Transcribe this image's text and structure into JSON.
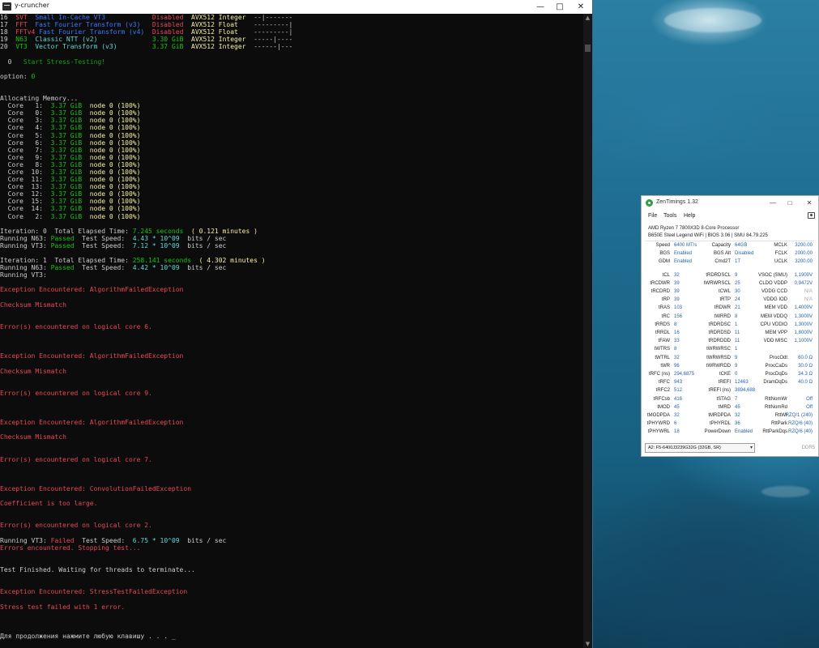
{
  "terminal": {
    "title": "y-cruncher",
    "lines": [
      [
        [
          "16  ",
          "w"
        ],
        [
          "SVT  ",
          "r"
        ],
        [
          "Small In-Cache VT3            ",
          "b"
        ],
        [
          "Disabled  ",
          "r"
        ],
        [
          "AVX512 Integer  ",
          "y"
        ],
        [
          "--|-------",
          "w"
        ]
      ],
      [
        [
          "17  ",
          "w"
        ],
        [
          "FFT  ",
          "r"
        ],
        [
          "Fast Fourier Transform (v3)   ",
          "b"
        ],
        [
          "Disabled  ",
          "r"
        ],
        [
          "AVX512 Float    ",
          "y"
        ],
        [
          "---------|",
          "w"
        ]
      ],
      [
        [
          "18  ",
          "w"
        ],
        [
          "FFTv4",
          "r"
        ],
        [
          " Fast Fourier Transform (v4)  ",
          "b"
        ],
        [
          "Disabled  ",
          "r"
        ],
        [
          "AVX512 Float    ",
          "y"
        ],
        [
          "---------|",
          "w"
        ]
      ],
      [
        [
          "19  ",
          "w"
        ],
        [
          "N63  ",
          "g"
        ],
        [
          "Classic NTT (v2)              ",
          "c"
        ],
        [
          "3.30 GiB  ",
          "g"
        ],
        [
          "AVX512 Integer  ",
          "y"
        ],
        [
          "-----|----",
          "w"
        ]
      ],
      [
        [
          "20  ",
          "w"
        ],
        [
          "VT3  ",
          "g"
        ],
        [
          "Vector Transform (v3)         ",
          "c"
        ],
        [
          "3.37 GiB  ",
          "g"
        ],
        [
          "AVX512 Integer  ",
          "y"
        ],
        [
          "------|---",
          "w"
        ]
      ],
      [],
      [
        [
          "  0   ",
          "w"
        ],
        [
          "Start Stress-Testing!",
          "lg"
        ]
      ],
      [],
      [
        [
          "option: ",
          "w"
        ],
        [
          "0",
          "g"
        ]
      ],
      [],
      [],
      [
        [
          "Allocating Memory...",
          "w"
        ]
      ],
      [
        [
          "  Core   1:  ",
          "w"
        ],
        [
          "3.37 GiB",
          "g"
        ],
        [
          "  node 0 (100%)",
          "y"
        ]
      ],
      [
        [
          "  Core   0:  ",
          "w"
        ],
        [
          "3.37 GiB",
          "g"
        ],
        [
          "  node 0 (100%)",
          "y"
        ]
      ],
      [
        [
          "  Core   3:  ",
          "w"
        ],
        [
          "3.37 GiB",
          "g"
        ],
        [
          "  node 0 (100%)",
          "y"
        ]
      ],
      [
        [
          "  Core   4:  ",
          "w"
        ],
        [
          "3.37 GiB",
          "g"
        ],
        [
          "  node 0 (100%)",
          "y"
        ]
      ],
      [
        [
          "  Core   5:  ",
          "w"
        ],
        [
          "3.37 GiB",
          "g"
        ],
        [
          "  node 0 (100%)",
          "y"
        ]
      ],
      [
        [
          "  Core   6:  ",
          "w"
        ],
        [
          "3.37 GiB",
          "g"
        ],
        [
          "  node 0 (100%)",
          "y"
        ]
      ],
      [
        [
          "  Core   7:  ",
          "w"
        ],
        [
          "3.37 GiB",
          "g"
        ],
        [
          "  node 0 (100%)",
          "y"
        ]
      ],
      [
        [
          "  Core   9:  ",
          "w"
        ],
        [
          "3.37 GiB",
          "g"
        ],
        [
          "  node 0 (100%)",
          "y"
        ]
      ],
      [
        [
          "  Core   8:  ",
          "w"
        ],
        [
          "3.37 GiB",
          "g"
        ],
        [
          "  node 0 (100%)",
          "y"
        ]
      ],
      [
        [
          "  Core  10:  ",
          "w"
        ],
        [
          "3.37 GiB",
          "g"
        ],
        [
          "  node 0 (100%)",
          "y"
        ]
      ],
      [
        [
          "  Core  11:  ",
          "w"
        ],
        [
          "3.37 GiB",
          "g"
        ],
        [
          "  node 0 (100%)",
          "y"
        ]
      ],
      [
        [
          "  Core  13:  ",
          "w"
        ],
        [
          "3.37 GiB",
          "g"
        ],
        [
          "  node 0 (100%)",
          "y"
        ]
      ],
      [
        [
          "  Core  12:  ",
          "w"
        ],
        [
          "3.37 GiB",
          "g"
        ],
        [
          "  node 0 (100%)",
          "y"
        ]
      ],
      [
        [
          "  Core  15:  ",
          "w"
        ],
        [
          "3.37 GiB",
          "g"
        ],
        [
          "  node 0 (100%)",
          "y"
        ]
      ],
      [
        [
          "  Core  14:  ",
          "w"
        ],
        [
          "3.37 GiB",
          "g"
        ],
        [
          "  node 0 (100%)",
          "y"
        ]
      ],
      [
        [
          "  Core   2:  ",
          "w"
        ],
        [
          "3.37 GiB",
          "g"
        ],
        [
          "  node 0 (100%)",
          "y"
        ]
      ],
      [],
      [
        [
          "Iteration: 0  Total Elapsed Time: ",
          "w"
        ],
        [
          "7.245 seconds",
          "g"
        ],
        [
          "  ( 0.121 minutes )",
          "y"
        ]
      ],
      [
        [
          "Running N63: ",
          "w"
        ],
        [
          "Passed",
          "g"
        ],
        [
          "  Test Speed:  ",
          "w"
        ],
        [
          "4.43 * 10^09",
          "c"
        ],
        [
          "  bits / sec",
          "w"
        ]
      ],
      [
        [
          "Running VT3: ",
          "w"
        ],
        [
          "Passed",
          "g"
        ],
        [
          "  Test Speed:  ",
          "w"
        ],
        [
          "7.12 * 10^09",
          "c"
        ],
        [
          "  bits / sec",
          "w"
        ]
      ],
      [],
      [
        [
          "Iteration: 1  Total Elapsed Time: ",
          "w"
        ],
        [
          "258.141 seconds",
          "g"
        ],
        [
          "  ( 4.302 minutes )",
          "y"
        ]
      ],
      [
        [
          "Running N63: ",
          "w"
        ],
        [
          "Passed",
          "g"
        ],
        [
          "  Test Speed:  ",
          "w"
        ],
        [
          "4.42 * 10^09",
          "c"
        ],
        [
          "  bits / sec",
          "w"
        ]
      ],
      [
        [
          "Running VT3:",
          "w"
        ]
      ],
      [],
      [
        [
          "Exception Encountered: AlgorithmFailedException",
          "r"
        ]
      ],
      [],
      [
        [
          "Checksum Mismatch",
          "r"
        ]
      ],
      [],
      [],
      [
        [
          "Error(s) encountered on logical core 6.",
          "r"
        ]
      ],
      [],
      [],
      [],
      [
        [
          "Exception Encountered: AlgorithmFailedException",
          "r"
        ]
      ],
      [],
      [
        [
          "Checksum Mismatch",
          "r"
        ]
      ],
      [],
      [],
      [
        [
          "Error(s) encountered on logical core 9.",
          "r"
        ]
      ],
      [],
      [],
      [],
      [
        [
          "Exception Encountered: AlgorithmFailedException",
          "r"
        ]
      ],
      [],
      [
        [
          "Checksum Mismatch",
          "r"
        ]
      ],
      [],
      [],
      [
        [
          "Error(s) encountered on logical core 7.",
          "r"
        ]
      ],
      [],
      [],
      [],
      [
        [
          "Exception Encountered: ConvolutionFailedException",
          "r"
        ]
      ],
      [],
      [
        [
          "Coefficient is too large.",
          "r"
        ]
      ],
      [],
      [],
      [
        [
          "Error(s) encountered on logical core 2.",
          "r"
        ]
      ],
      [],
      [
        [
          "Running VT3: ",
          "w"
        ],
        [
          "Failed",
          "r"
        ],
        [
          "  Test Speed:  ",
          "w"
        ],
        [
          "6.75 * 10^09",
          "c"
        ],
        [
          "  bits / sec",
          "w"
        ]
      ],
      [
        [
          "Errors encountered. Stopping test...",
          "r"
        ]
      ],
      [],
      [],
      [
        [
          "Test Finished. Waiting for threads to terminate...",
          "w"
        ]
      ],
      [],
      [],
      [
        [
          "Exception Encountered: StressTestFailedException",
          "r"
        ]
      ],
      [],
      [
        [
          "Stress test failed with 1 error.",
          "r"
        ]
      ],
      [],
      [],
      [],
      [
        [
          "Для продолжения нажмите любую клавишу . . . _",
          "w"
        ]
      ]
    ]
  },
  "zentimings": {
    "title": "ZenTimings 1.32",
    "menu": [
      "File",
      "Tools",
      "Help"
    ],
    "cpu": "AMD Ryzen 7 7800X3D 8-Core Processor",
    "board": "B650E Steel Legend WiFi | BIOS 3.06 | SMU 84.79.225",
    "rows": [
      [
        [
          "Speed",
          "6400 MT/s"
        ],
        [
          "Capacity",
          "64GB"
        ],
        [
          "MCLK",
          "3200.00"
        ]
      ],
      [
        [
          "BGS",
          "Enabled"
        ],
        [
          "BGS Alt",
          "Disabled"
        ],
        [
          "FCLK",
          "2000.00"
        ]
      ],
      [
        [
          "GDM",
          "Enabled"
        ],
        [
          "Cmd2T",
          "1T"
        ],
        [
          "UCLK",
          "3200.00"
        ]
      ],
      null,
      [
        [
          "tCL",
          "32"
        ],
        [
          "tRDRDSCL",
          "9"
        ],
        [
          "VSOC (SMU)",
          "1,1900V"
        ]
      ],
      [
        [
          "tRCDWR",
          "39"
        ],
        [
          "tWRWRSCL",
          "25"
        ],
        [
          "CLDO VDDP",
          "0,9472V"
        ]
      ],
      [
        [
          "tRCDRD",
          "39"
        ],
        [
          "tCWL",
          "30"
        ],
        [
          "VDDG CCD",
          "N/A"
        ]
      ],
      [
        [
          "tRP",
          "39"
        ],
        [
          "tRTP",
          "24"
        ],
        [
          "VDDG IOD",
          "N/A"
        ]
      ],
      [
        [
          "tRAS",
          "103"
        ],
        [
          "tRDWR",
          "21"
        ],
        [
          "MEM VDD",
          "1,4000V"
        ]
      ],
      [
        [
          "tRC",
          "156"
        ],
        [
          "tWRRD",
          "8"
        ],
        [
          "MEM VDDQ",
          "1,3000V"
        ]
      ],
      [
        [
          "tRRDS",
          "8"
        ],
        [
          "tRDRDSC",
          "1"
        ],
        [
          "CPU VDDIO",
          "1,3000V"
        ]
      ],
      [
        [
          "tRRDL",
          "16"
        ],
        [
          "tRDRDSD",
          "11"
        ],
        [
          "MEM VPP",
          "1,8000V"
        ]
      ],
      [
        [
          "tFAW",
          "33"
        ],
        [
          "tRDRDDD",
          "11"
        ],
        [
          "VDD MISC",
          "1,1000V"
        ]
      ],
      [
        [
          "tWTRS",
          "8"
        ],
        [
          "tWRWRSC",
          "1"
        ],
        [
          "",
          ""
        ]
      ],
      [
        [
          "tWTRL",
          "32"
        ],
        [
          "tWRWRSD",
          "9"
        ],
        [
          "ProcOdt",
          "60.0 Ω"
        ]
      ],
      [
        [
          "tWR",
          "96"
        ],
        [
          "tWRWRDD",
          "9"
        ],
        [
          "ProcCaDs",
          "30.0 Ω"
        ]
      ],
      [
        [
          "tRFC (ns)",
          "294,6875"
        ],
        [
          "tCKE",
          "0"
        ],
        [
          "ProcDqDs",
          "34.3 Ω"
        ]
      ],
      [
        [
          "tRFC",
          "943"
        ],
        [
          "tREFI",
          "12463"
        ],
        [
          "DramDqDs",
          "40.0 Ω"
        ]
      ],
      [
        [
          "tRFC2",
          "512"
        ],
        [
          "tREFI (ns)",
          "3894,688"
        ],
        [
          "",
          ""
        ]
      ],
      [
        [
          "tRFCsb",
          "416"
        ],
        [
          "tSTAG",
          "7"
        ],
        [
          "RttNomWr",
          "Off"
        ]
      ],
      [
        [
          "tMOD",
          "45"
        ],
        [
          "tMRD",
          "45"
        ],
        [
          "RttNomRd",
          "Off"
        ]
      ],
      [
        [
          "tMODPDA",
          "32"
        ],
        [
          "tMRDPDA",
          "32"
        ],
        [
          "RttWr",
          "RZQ/1 (240)"
        ]
      ],
      [
        [
          "tPHYWRD",
          "6"
        ],
        [
          "tPHYRDL",
          "36"
        ],
        [
          "RttPark",
          "RZQ/6 (40)"
        ]
      ],
      [
        [
          "tPHYWRL",
          "18"
        ],
        [
          "PowerDown",
          "Enabled"
        ],
        [
          "RttParkDqs",
          "RZQ/6 (40)"
        ]
      ]
    ],
    "dimm_select": "A2: F5-6400J3239G32G (32GB, SR)",
    "mem_type": "DDR5"
  },
  "colors": {
    "white": "#cccccc",
    "red": "#e74856",
    "green": "#16c60c",
    "yellow": "#f9f1a5",
    "blue": "#3b78ff",
    "cyan": "#61d6d6",
    "zen_value": "#2563b0"
  }
}
